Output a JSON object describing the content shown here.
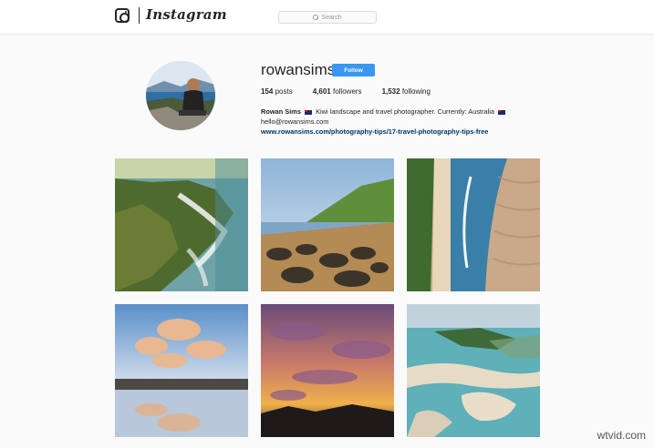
{
  "app": {
    "wordmark": "Instagram",
    "search_placeholder": "Search"
  },
  "profile": {
    "username": "rowansims",
    "follow_label": "Follow",
    "stats": {
      "posts_count": "154",
      "posts_label": "posts",
      "followers_count": "4,601",
      "followers_label": "followers",
      "following_count": "1,532",
      "following_label": "following"
    },
    "bio": {
      "name": "Rowan Sims",
      "text": "Kiwi landscape and travel photographer. Currently: Australia",
      "email": "hello@rowansims.com",
      "link": "www.rowansims.com/photography-tips/17-travel-photography-tips-free"
    }
  },
  "posts": [
    {
      "subject": "aerial coastal headland with surf"
    },
    {
      "subject": "rocky beach at golden hour"
    },
    {
      "subject": "aerial river mouth and sand flats"
    },
    {
      "subject": "clouds reflected in tidal pool"
    },
    {
      "subject": "vivid sunset sky over hills"
    },
    {
      "subject": "aerial estuary with turquoise water"
    }
  ],
  "watermark": "wtvid.com",
  "colors": {
    "accent": "#3897f0",
    "link": "#003569",
    "text": "#262626",
    "background": "#fafafa"
  },
  "icons": {
    "camera": "instagram-camera-icon",
    "search": "search-icon",
    "flag": "nz-flag-icon"
  }
}
